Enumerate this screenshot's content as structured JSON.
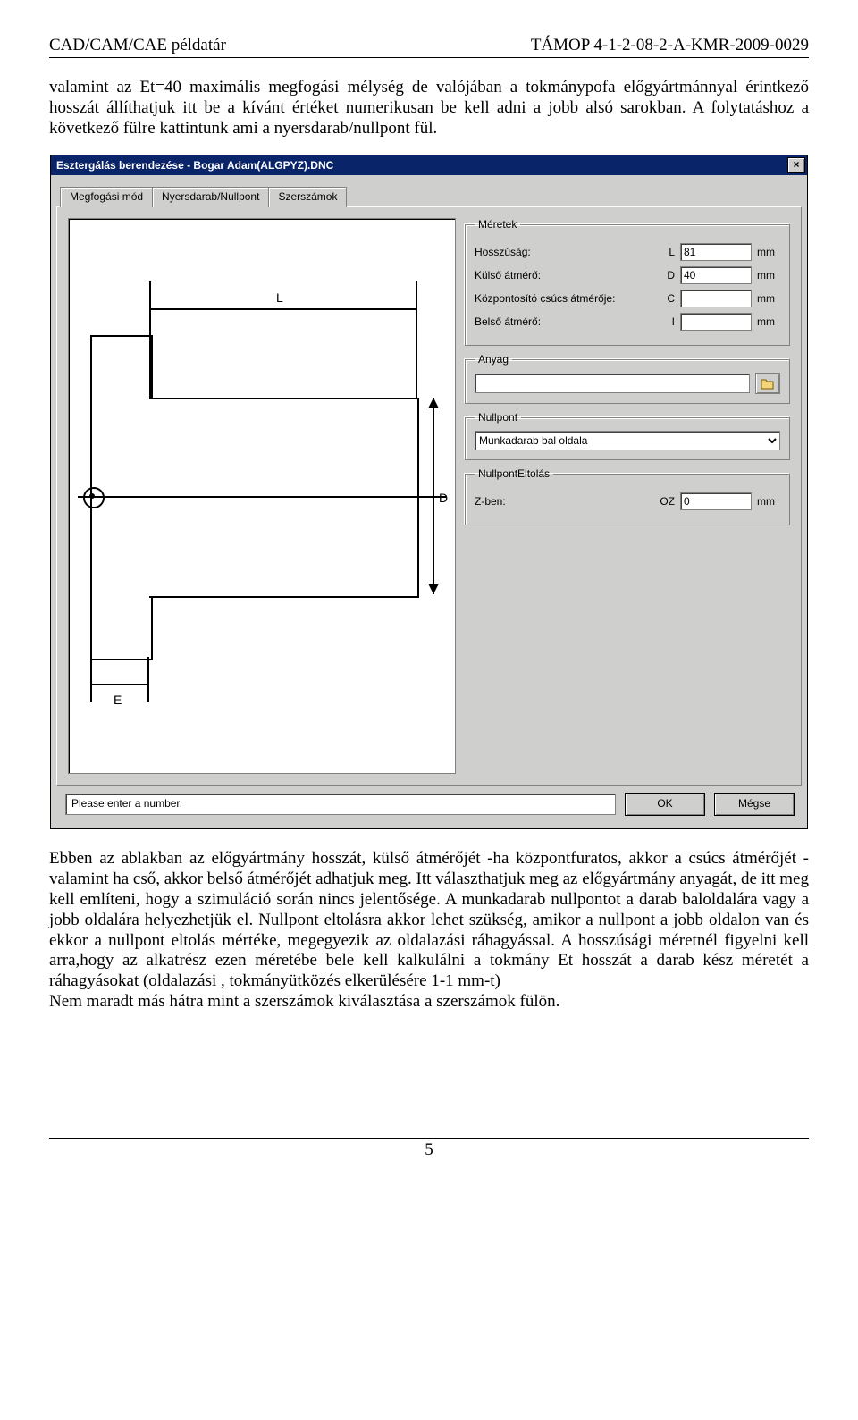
{
  "header": {
    "left": "CAD/CAM/CAE példatár",
    "right": "TÁMOP 4-1-2-08-2-A-KMR-2009-0029"
  },
  "para1": "valamint az Et=40 maximális megfogási mélység de valójában a tokmánypofa előgyártmánnyal érintkező hosszát állíthatjuk itt be a kívánt értéket numerikusan be kell adni a jobb alsó sarokban. A folytatáshoz a következő fülre kattintunk ami a nyersdarab/nullpont fül.",
  "para2": "Ebben az ablakban az előgyártmány hosszát, külső átmérőjét -ha központfuratos, akkor a csúcs átmérőjét -valamint ha cső, akkor belső átmérőjét adhatjuk meg. Itt választhatjuk meg az előgyártmány anyagát, de itt meg kell említeni, hogy a szimuláció során nincs jelentősége. A munkadarab nullpontot a darab baloldalára vagy a jobb oldalára helyezhetjük el. Nullpont eltolásra akkor lehet szükség, amikor a nullpont a jobb oldalon van és ekkor a nullpont eltolás mértéke, megegyezik az oldalazási ráhagyással. A hosszúsági méretnél figyelni kell arra,hogy az alkatrész ezen méretébe bele kell kalkulálni a tokmány Et hosszát a darab kész méretét a ráhagyásokat (oldalazási , tokmányütközés elkerülésére 1-1 mm-t)\nNem maradt más hátra mint a szerszámok kiválasztása a szerszámok fülön.",
  "page_number": "5",
  "dialog": {
    "title": "Esztergálás berendezése - Bogar Adam(ALGPYZ).DNC",
    "tabs": [
      "Megfogási mód",
      "Nyersdarab/Nullpont",
      "Szerszámok"
    ],
    "meretek": {
      "legend": "Méretek",
      "rows": [
        {
          "label": "Hosszúság:",
          "sym": "L",
          "value": "81",
          "unit": "mm"
        },
        {
          "label": "Külső átmérő:",
          "sym": "D",
          "value": "40",
          "unit": "mm"
        },
        {
          "label": "Központosító csúcs átmérője:",
          "sym": "C",
          "value": "",
          "unit": "mm"
        },
        {
          "label": "Belső átmérő:",
          "sym": "I",
          "value": "",
          "unit": "mm"
        }
      ]
    },
    "anyag": {
      "legend": "Anyag",
      "value": ""
    },
    "nullpont": {
      "legend": "Nullpont",
      "selected": "Munkadarab bal oldala"
    },
    "eltolas": {
      "legend": "NullpontEltolás",
      "label": "Z-ben:",
      "sym": "OZ",
      "value": "0",
      "unit": "mm"
    },
    "drawing_labels": {
      "L": "L",
      "D": "D",
      "E": "E"
    },
    "status": "Please enter a number.",
    "ok": "OK",
    "cancel": "Mégse"
  }
}
